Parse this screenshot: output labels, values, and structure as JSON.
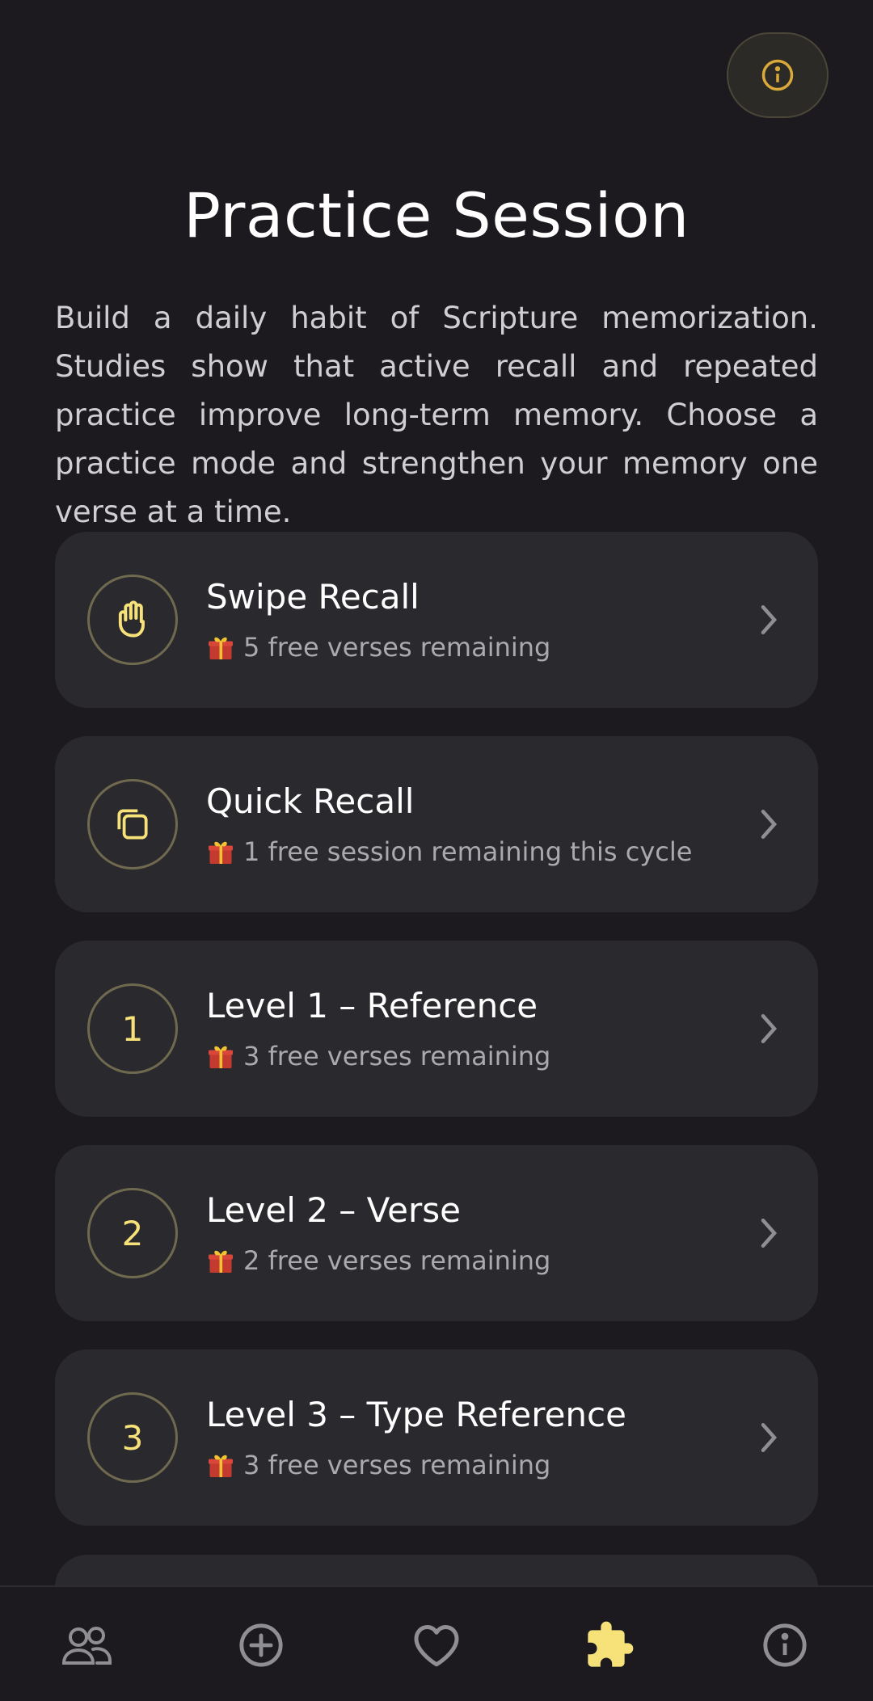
{
  "header": {
    "title": "Practice Session",
    "intro": "Build a daily habit of Scripture memorization. Studies show that active recall and repeated practice improve long-term memory. Choose a practice mode and strengthen your memory one verse at a time."
  },
  "top_button": {
    "icon": "info-icon"
  },
  "modes": [
    {
      "title": "Swipe Recall",
      "subtitle": "5 free verses remaining",
      "icon": "hand-icon"
    },
    {
      "title": "Quick Recall",
      "subtitle": "1 free session remaining this cycle",
      "icon": "cards-icon"
    },
    {
      "title": "Level 1 – Reference",
      "subtitle": "3 free verses remaining",
      "badge": "1"
    },
    {
      "title": "Level 2 – Verse",
      "subtitle": "2 free verses remaining",
      "badge": "2"
    },
    {
      "title": "Level 3 – Type Reference",
      "subtitle": "3 free verses remaining",
      "badge": "3"
    }
  ],
  "nav": [
    {
      "name": "people-icon",
      "active": false
    },
    {
      "name": "add-circle-icon",
      "active": false
    },
    {
      "name": "heart-icon",
      "active": false
    },
    {
      "name": "puzzle-icon",
      "active": true
    },
    {
      "name": "info-icon",
      "active": false
    }
  ],
  "colors": {
    "background": "#1c1a1f",
    "card": "#2a292e",
    "accent": "#f7e27a",
    "badge_border": "#6f6a4f",
    "muted_text": "#a9a9ae"
  }
}
